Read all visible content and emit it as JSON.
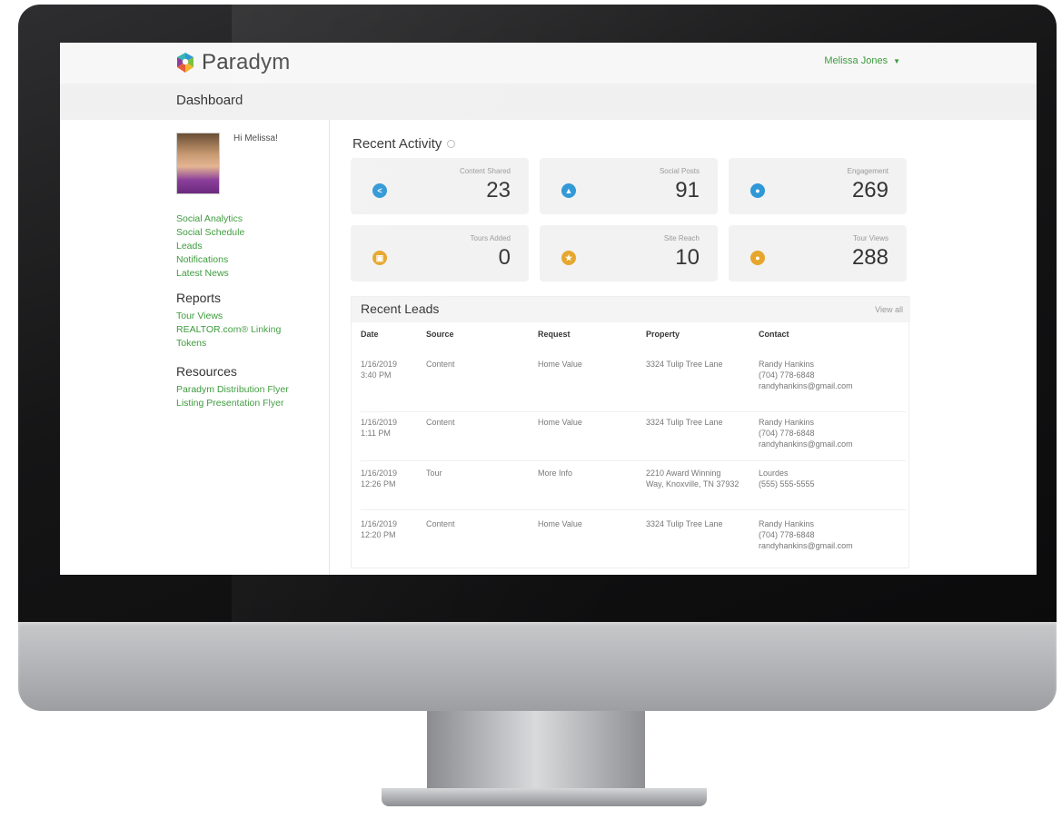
{
  "brand": {
    "name": "Paradym"
  },
  "user": {
    "name": "Melissa Jones"
  },
  "page": {
    "title": "Dashboard"
  },
  "sidebar": {
    "greeting": "Hi Melissa!",
    "links": [
      "Social Analytics",
      "Social Schedule",
      "Leads",
      "Notifications",
      "Latest News"
    ],
    "reports": {
      "heading": "Reports",
      "links": [
        "Tour Views",
        "REALTOR.com® Linking",
        "Tokens"
      ]
    },
    "resources": {
      "heading": "Resources",
      "links": [
        "Paradym Distribution Flyer",
        "Listing Presentation Flyer"
      ]
    }
  },
  "recent_activity": {
    "title": "Recent Activity",
    "stats": [
      {
        "label": "Content Shared",
        "value": "23",
        "icon": "share-icon",
        "color": "#2f97d6"
      },
      {
        "label": "Social Posts",
        "value": "91",
        "icon": "thumbs-up-icon",
        "color": "#2f97d6"
      },
      {
        "label": "Engagement",
        "value": "269",
        "icon": "person-icon",
        "color": "#2f97d6"
      },
      {
        "label": "Tours Added",
        "value": "0",
        "icon": "image-icon",
        "color": "#e6a52b"
      },
      {
        "label": "Site Reach",
        "value": "10",
        "icon": "star-icon",
        "color": "#e6a52b"
      },
      {
        "label": "Tour Views",
        "value": "288",
        "icon": "person-icon",
        "color": "#e6a52b"
      }
    ]
  },
  "recent_leads": {
    "title": "Recent Leads",
    "view_all": "View all",
    "columns": [
      "Date",
      "Source",
      "Request",
      "Property",
      "Contact"
    ],
    "rows": [
      {
        "date": "1/16/2019",
        "time": "3:40 PM",
        "source": "Content",
        "request": "Home Value",
        "property_1": "3324 Tulip Tree Lane",
        "property_2": "",
        "contact_name": "Randy Hankins",
        "contact_phone": "(704) 778-6848",
        "contact_email": "randyhankins@gmail.com"
      },
      {
        "date": "1/16/2019",
        "time": "1:11 PM",
        "source": "Content",
        "request": "Home Value",
        "property_1": "3324 Tulip Tree Lane",
        "property_2": "",
        "contact_name": "Randy Hankins",
        "contact_phone": "(704) 778-6848",
        "contact_email": "randyhankins@gmail.com"
      },
      {
        "date": "1/16/2019",
        "time": "12:26 PM",
        "source": "Tour",
        "request": "More Info",
        "property_1": "2210 Award Winning",
        "property_2": "Way, Knoxville, TN 37932",
        "contact_name": "Lourdes",
        "contact_phone": "(555) 555-5555",
        "contact_email": ""
      },
      {
        "date": "1/16/2019",
        "time": "12:20 PM",
        "source": "Content",
        "request": "Home Value",
        "property_1": "3324 Tulip Tree Lane",
        "property_2": "",
        "contact_name": "Randy Hankins",
        "contact_phone": "(704) 778-6848",
        "contact_email": "randyhankins@gmail.com"
      }
    ]
  }
}
